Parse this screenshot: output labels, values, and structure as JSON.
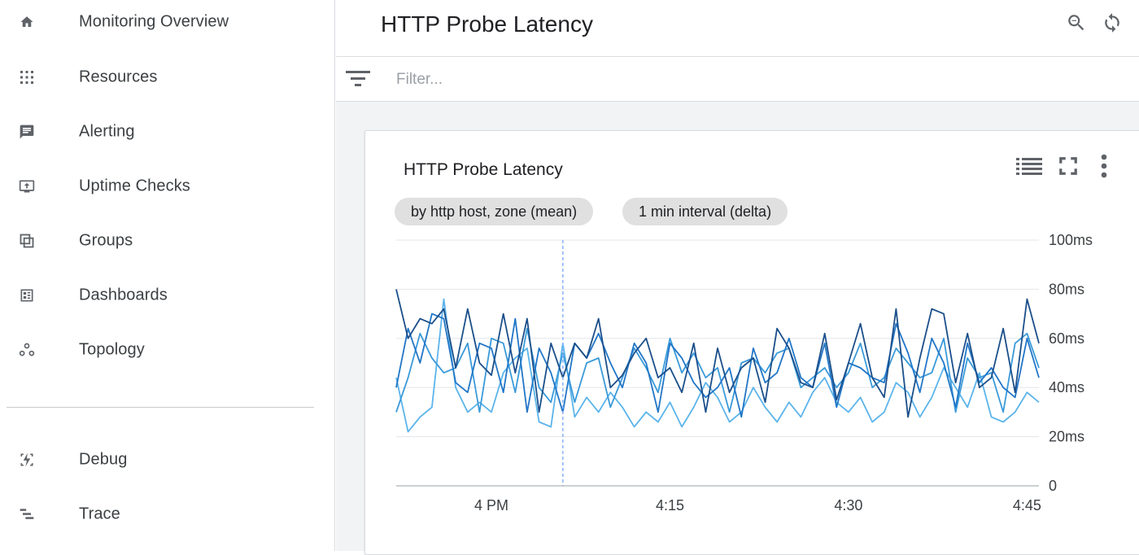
{
  "sidebar": {
    "items": [
      {
        "label": "Monitoring Overview",
        "icon": "home-icon"
      },
      {
        "label": "Resources",
        "icon": "grid-icon"
      },
      {
        "label": "Alerting",
        "icon": "alert-comment-icon"
      },
      {
        "label": "Uptime Checks",
        "icon": "monitor-upload-icon"
      },
      {
        "label": "Groups",
        "icon": "groups-icon"
      },
      {
        "label": "Dashboards",
        "icon": "dashboard-icon"
      },
      {
        "label": "Topology",
        "icon": "topology-icon"
      }
    ],
    "bottom_items": [
      {
        "label": "Debug",
        "icon": "debug-icon"
      },
      {
        "label": "Trace",
        "icon": "trace-icon"
      }
    ]
  },
  "header": {
    "title": "HTTP Probe Latency",
    "actions": [
      "zoom-out-icon",
      "refresh-icon"
    ]
  },
  "filter": {
    "placeholder": "Filter...",
    "value": ""
  },
  "card": {
    "title": "HTTP Probe Latency",
    "chips": [
      "by http host, zone (mean)",
      "1 min interval (delta)"
    ],
    "actions": [
      "legend-list-icon",
      "fullscreen-icon",
      "more-vert-icon"
    ]
  },
  "colors": {
    "accent": "#1a73e8",
    "series": [
      "#1b4f8a",
      "#2176c7",
      "#3a9ad9",
      "#5bb4ea"
    ],
    "cursor": "#8ab4f8"
  },
  "chart_data": {
    "type": "line",
    "title": "",
    "ylim": [
      0,
      100
    ],
    "yticks": [
      0,
      20,
      40,
      60,
      80,
      100
    ],
    "ytick_labels": [
      "0",
      "20ms",
      "40ms",
      "60ms",
      "80ms",
      "100ms"
    ],
    "xticks": [
      "4 PM",
      "4:15",
      "4:30",
      "4:45"
    ],
    "grid": true,
    "cursor_time": "4:06",
    "x": [
      "3:52",
      "3:53",
      "3:54",
      "3:55",
      "3:56",
      "3:57",
      "3:58",
      "3:59",
      "4:00",
      "4:01",
      "4:02",
      "4:03",
      "4:04",
      "4:05",
      "4:06",
      "4:07",
      "4:08",
      "4:09",
      "4:10",
      "4:11",
      "4:12",
      "4:13",
      "4:14",
      "4:15",
      "4:16",
      "4:17",
      "4:18",
      "4:19",
      "4:20",
      "4:21",
      "4:22",
      "4:23",
      "4:24",
      "4:25",
      "4:26",
      "4:27",
      "4:28",
      "4:29",
      "4:30",
      "4:31",
      "4:32",
      "4:33",
      "4:34",
      "4:35",
      "4:36",
      "4:37",
      "4:38",
      "4:39",
      "4:40",
      "4:41",
      "4:42",
      "4:43",
      "4:44",
      "4:45",
      "4:46"
    ],
    "series": [
      {
        "values": [
          80,
          60,
          68,
          66,
          72,
          48,
          72,
          50,
          45,
          70,
          46,
          68,
          30,
          58,
          44,
          58,
          52,
          68,
          40,
          45,
          54,
          60,
          44,
          48,
          38,
          58,
          30,
          56,
          38,
          48,
          52,
          34,
          64,
          56,
          42,
          40,
          62,
          35,
          50,
          66,
          44,
          36,
          72,
          28,
          52,
          72,
          70,
          42,
          62,
          40,
          44,
          64,
          38,
          76,
          58
        ]
      },
      {
        "values": [
          40,
          64,
          50,
          70,
          68,
          42,
          38,
          58,
          56,
          38,
          68,
          30,
          56,
          46,
          30,
          58,
          52,
          62,
          50,
          40,
          58,
          50,
          30,
          58,
          52,
          42,
          36,
          40,
          48,
          28,
          56,
          42,
          46,
          60,
          44,
          40,
          58,
          32,
          50,
          48,
          44,
          42,
          66,
          54,
          38,
          60,
          50,
          32,
          58,
          42,
          48,
          40,
          36,
          60,
          44
        ]
      },
      {
        "values": [
          30,
          44,
          62,
          52,
          46,
          48,
          58,
          30,
          60,
          58,
          38,
          64,
          40,
          34,
          54,
          34,
          50,
          52,
          32,
          44,
          56,
          48,
          38,
          60,
          46,
          54,
          44,
          48,
          30,
          50,
          52,
          46,
          54,
          56,
          40,
          44,
          48,
          40,
          46,
          58,
          40,
          44,
          56,
          50,
          44,
          46,
          60,
          30,
          52,
          44,
          46,
          30,
          58,
          62,
          48
        ]
      },
      {
        "values": [
          44,
          22,
          28,
          32,
          76,
          40,
          30,
          34,
          30,
          46,
          52,
          56,
          26,
          24,
          58,
          28,
          36,
          30,
          38,
          32,
          24,
          30,
          26,
          34,
          24,
          32,
          42,
          36,
          26,
          30,
          40,
          32,
          26,
          34,
          28,
          38,
          44,
          34,
          30,
          36,
          26,
          30,
          42,
          38,
          28,
          36,
          48,
          40,
          32,
          46,
          28,
          26,
          30,
          38,
          34
        ]
      }
    ]
  }
}
